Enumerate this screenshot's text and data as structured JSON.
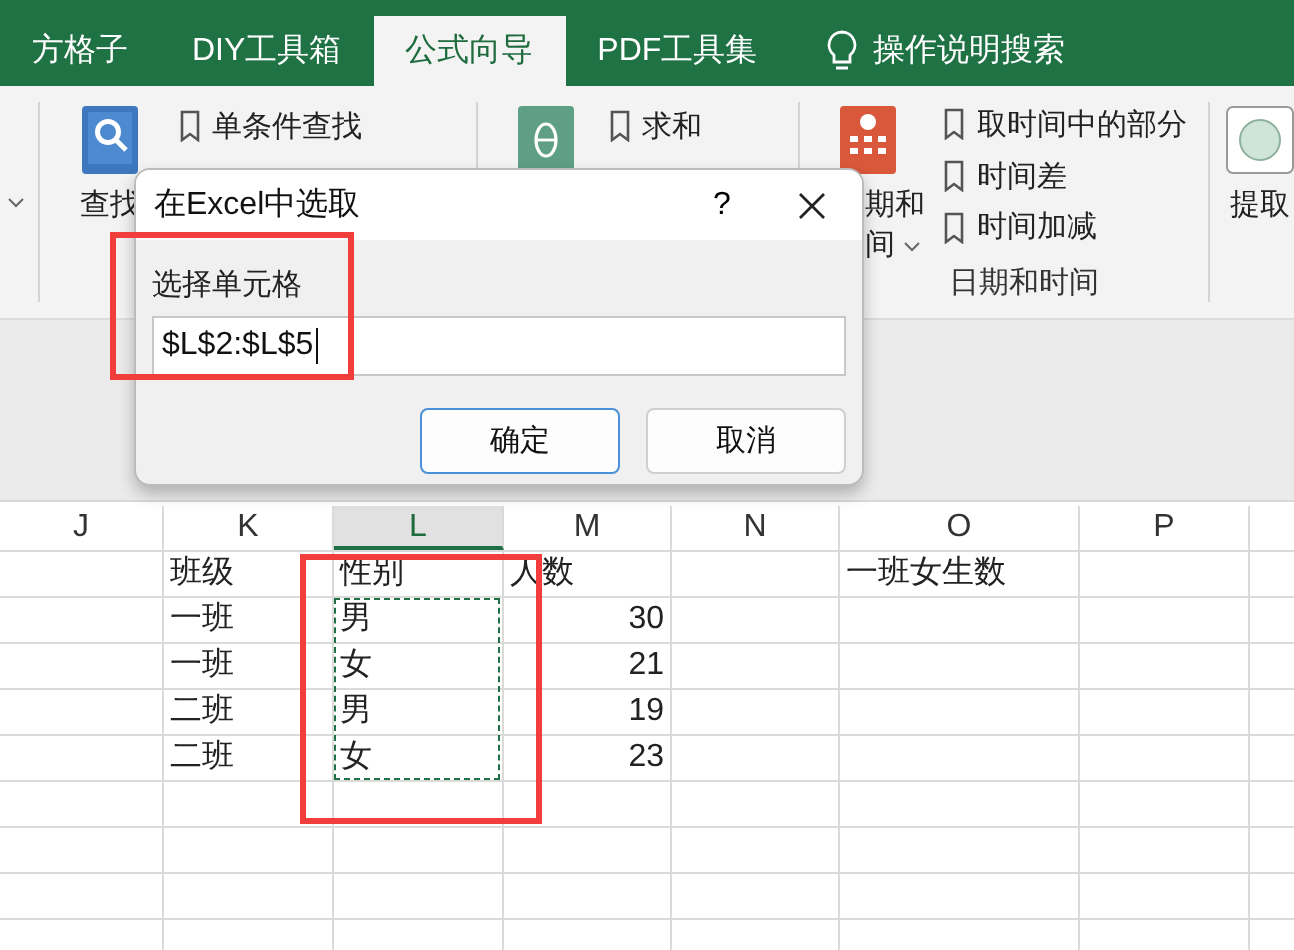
{
  "tabs": [
    {
      "label": "方格子",
      "selected": false
    },
    {
      "label": "DIY工具箱",
      "selected": false
    },
    {
      "label": "公式向导",
      "selected": true
    },
    {
      "label": "PDF工具集",
      "selected": false
    }
  ],
  "search": {
    "label": "操作说明搜索"
  },
  "ribbon": {
    "find_group": {
      "button": "查找",
      "items": [
        "单条件查找"
      ]
    },
    "math_group": {
      "items": [
        "求和"
      ]
    },
    "date_group": {
      "button_lines": [
        "期和",
        "间"
      ],
      "items": [
        "取时间中的部分",
        "时间差",
        "时间加减"
      ],
      "label": "日期和时间"
    },
    "extract_group": {
      "button": "提取"
    }
  },
  "sheet": {
    "columns": [
      {
        "label": "J",
        "selected": false,
        "highlighted": false
      },
      {
        "label": "K",
        "selected": false,
        "highlighted": false
      },
      {
        "label": "L",
        "selected": true,
        "highlighted": true
      },
      {
        "label": "M",
        "selected": false,
        "highlighted": false
      },
      {
        "label": "N",
        "selected": false,
        "highlighted": false
      },
      {
        "label": "O",
        "selected": false,
        "highlighted": false
      },
      {
        "label": "P",
        "selected": false,
        "highlighted": false
      }
    ],
    "rows": [
      {
        "K": {
          "text": "班级"
        },
        "L": {
          "text": "性别"
        },
        "M": {
          "text": "人数"
        },
        "O": {
          "text": "一班女生数"
        }
      },
      {
        "K": {
          "text": "一班"
        },
        "L": {
          "text": "男",
          "marquee": true
        },
        "M": {
          "text": "30",
          "kind": "number"
        }
      },
      {
        "K": {
          "text": "一班"
        },
        "L": {
          "text": "女",
          "marquee": true
        },
        "M": {
          "text": "21",
          "kind": "number"
        }
      },
      {
        "K": {
          "text": "二班"
        },
        "L": {
          "text": "男",
          "marquee": true
        },
        "M": {
          "text": "19",
          "kind": "number"
        }
      },
      {
        "K": {
          "text": "二班"
        },
        "L": {
          "text": "女",
          "marquee": true
        },
        "M": {
          "text": "23",
          "kind": "number"
        }
      }
    ]
  },
  "dialog": {
    "title": "在Excel中选取",
    "help": "?",
    "field": {
      "label": "选择单元格",
      "value": "$L$2:$L$5",
      "highlighted": true
    },
    "buttons": [
      {
        "label": "确定",
        "default": true
      },
      {
        "label": "取消",
        "default": false
      }
    ]
  }
}
